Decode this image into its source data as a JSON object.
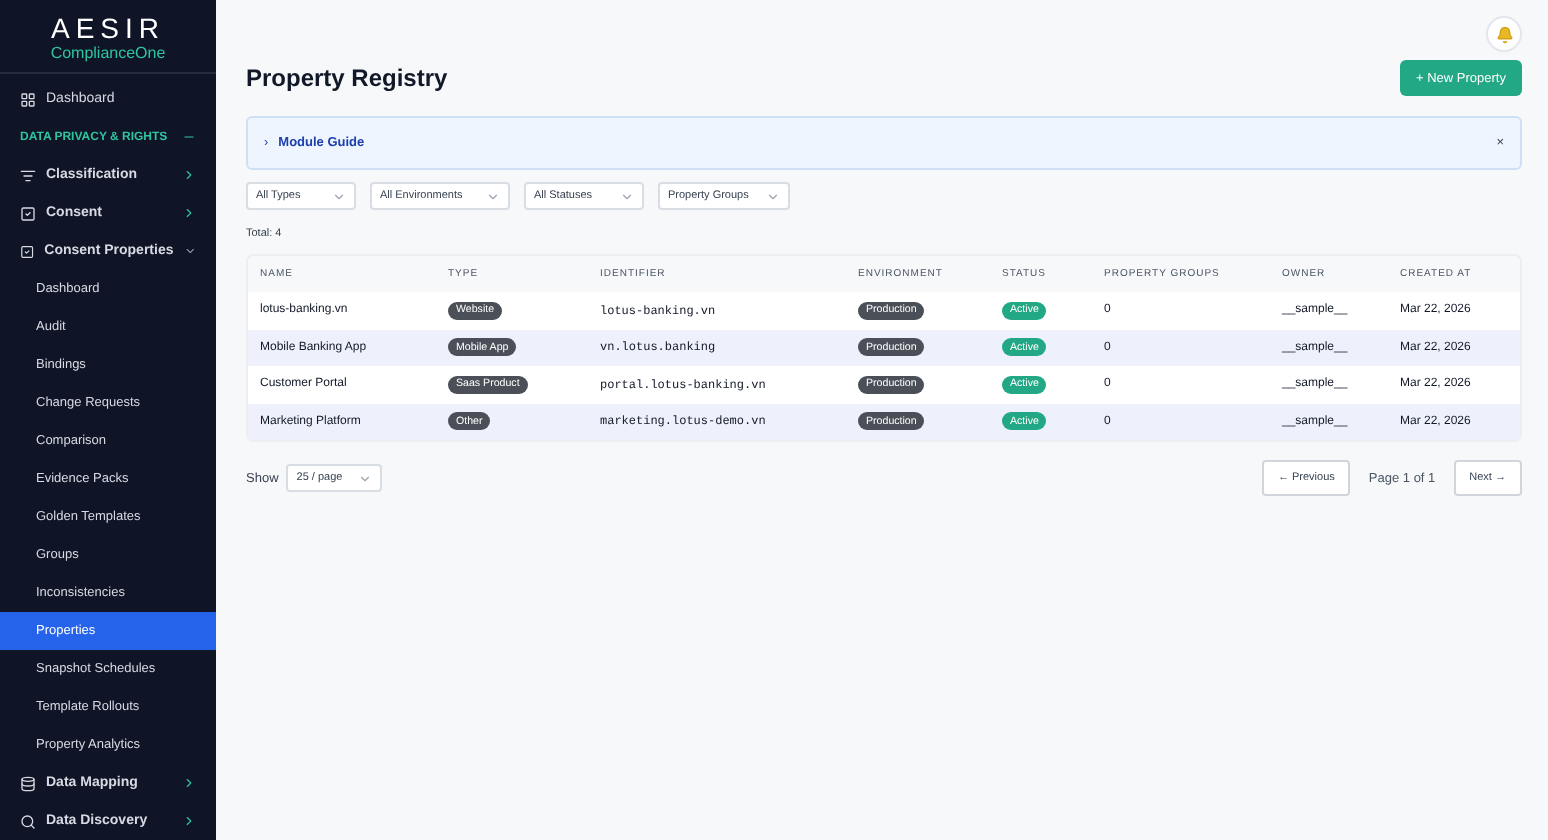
{
  "logo": {
    "name": "AESIR",
    "product": "ComplianceOne"
  },
  "sidebar": {
    "items": [
      {
        "kind": "link",
        "label": "Dashboard"
      },
      {
        "kind": "section",
        "label": "DATA PRIVACY & RIGHTS",
        "expanded": true
      },
      {
        "kind": "group",
        "label": "Classification",
        "expanded": false
      },
      {
        "kind": "group",
        "label": "Consent",
        "expanded": false
      },
      {
        "kind": "group",
        "label": "Consent Properties",
        "expanded": true,
        "children": [
          {
            "label": "Dashboard",
            "selected": false
          },
          {
            "label": "Audit",
            "selected": false
          },
          {
            "label": "Bindings",
            "selected": false
          },
          {
            "label": "Change Requests",
            "selected": false
          },
          {
            "label": "Comparison",
            "selected": false
          },
          {
            "label": "Evidence Packs",
            "selected": false
          },
          {
            "label": "Golden Templates",
            "selected": false
          },
          {
            "label": "Groups",
            "selected": false
          },
          {
            "label": "Inconsistencies",
            "selected": false
          },
          {
            "label": "Properties",
            "selected": true
          },
          {
            "label": "Snapshot Schedules",
            "selected": false
          },
          {
            "label": "Template Rollouts",
            "selected": false
          },
          {
            "label": "Property Analytics",
            "selected": false
          }
        ]
      },
      {
        "kind": "group",
        "label": "Data Mapping",
        "expanded": false
      },
      {
        "kind": "group",
        "label": "Data Discovery",
        "expanded": false
      }
    ]
  },
  "page": {
    "title": "Property Registry",
    "new_button": "+ New Property"
  },
  "guide": {
    "bullet": "›",
    "label": "Module Guide",
    "close": "×",
    "expanded": false
  },
  "filters": [
    "All Types",
    "All Environments",
    "All Statuses",
    "Property Groups"
  ],
  "total": "Total: 4",
  "table": {
    "columns": [
      "NAME",
      "TYPE",
      "IDENTIFIER",
      "ENVIRONMENT",
      "STATUS",
      "PROPERTY GROUPS",
      "OWNER",
      "CREATED AT"
    ],
    "rows": [
      {
        "name": "lotus-banking.vn",
        "type": "Website",
        "identifier": "lotus-banking.vn",
        "environment": "Production",
        "status": "Active",
        "groups": "0",
        "owner": "__sample__",
        "created": "Mar 22, 2026"
      },
      {
        "name": "Mobile Banking App",
        "type": "Mobile App",
        "identifier": "vn.lotus.banking",
        "environment": "Production",
        "status": "Active",
        "groups": "0",
        "owner": "__sample__",
        "created": "Mar 22, 2026"
      },
      {
        "name": "Customer Portal",
        "type": "Saas Product",
        "identifier": "portal.lotus-banking.vn",
        "environment": "Production",
        "status": "Active",
        "groups": "0",
        "owner": "__sample__",
        "created": "Mar 22, 2026"
      },
      {
        "name": "Marketing Platform",
        "type": "Other",
        "identifier": "marketing.lotus-demo.vn",
        "environment": "Production",
        "status": "Active",
        "groups": "0",
        "owner": "__sample__",
        "created": "Mar 22, 2026"
      }
    ]
  },
  "pagination": {
    "show_label": "Show",
    "page_size": "25 / page",
    "previous": "← Previous",
    "page_info": "Page 1 of 1",
    "next": "Next →"
  }
}
